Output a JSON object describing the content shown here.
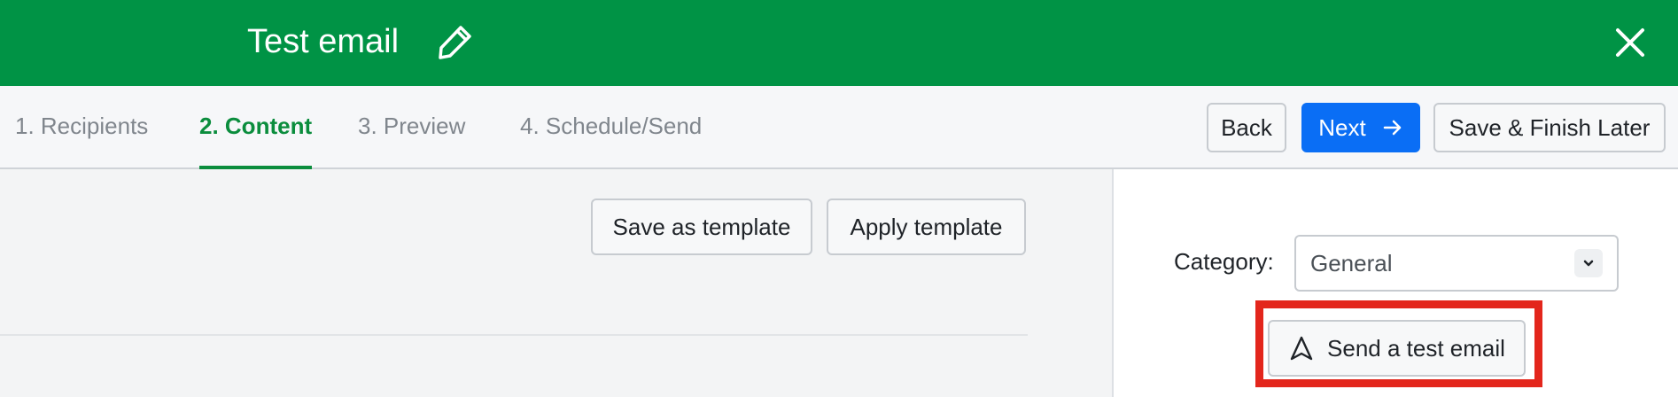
{
  "header": {
    "title": "Test email",
    "background_color": "#009345",
    "edit_icon": "pencil-icon",
    "close_icon": "close-icon"
  },
  "steps": {
    "tabs": [
      {
        "label": "1. Recipients",
        "active": false
      },
      {
        "label": "2. Content",
        "active": true
      },
      {
        "label": "3. Preview",
        "active": false
      },
      {
        "label": "4. Schedule/Send",
        "active": false
      }
    ],
    "active_color": "#0b8d3d"
  },
  "actions": {
    "back_label": "Back",
    "next_label": "Next",
    "next_icon": "arrow-right-icon",
    "save_finish_label": "Save & Finish Later",
    "primary_color": "#0a6ef5"
  },
  "template": {
    "save_label": "Save as template",
    "apply_label": "Apply template"
  },
  "sidebar": {
    "category_label": "Category:",
    "category_value": "General",
    "send_test_label": "Send a test email",
    "send_test_icon": "send-icon",
    "highlight_color": "#e3261c"
  }
}
